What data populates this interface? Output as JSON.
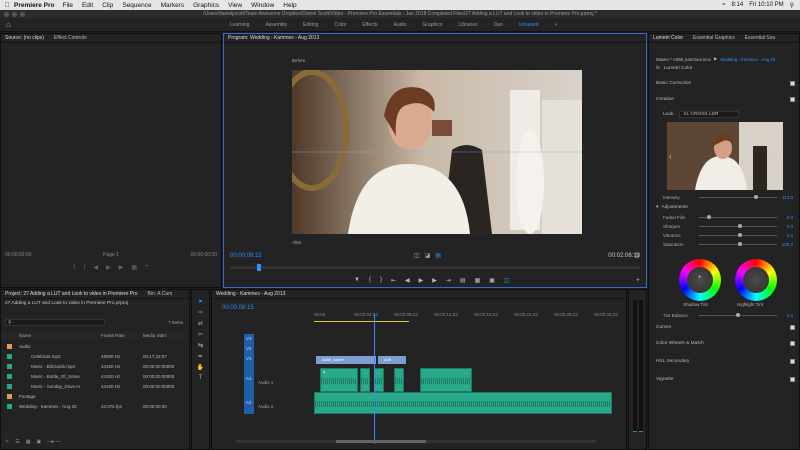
{
  "menubar": {
    "app": "Premiere Pro",
    "items": [
      "File",
      "Edit",
      "Clip",
      "Sequence",
      "Markers",
      "Graphics",
      "View",
      "Window",
      "Help"
    ],
    "right": [
      "8:14",
      "Fri 10:10 PM"
    ]
  },
  "pathbar": {
    "text": "/Users/danieljscott/Team Awesome Dropbox/Daniel Scott/Video - Premiere Pro Essentials - Jan 2018 Completed Files/27 Adding a LUT and Look to video in Premiere Pro.prproj *"
  },
  "workspaces": {
    "tabs": [
      "Learning",
      "Assembly",
      "Editing",
      "Color",
      "Effects",
      "Audio",
      "Graphics",
      "Libraries",
      "Dan",
      "Unsaved"
    ],
    "active": "Unsaved"
  },
  "source": {
    "tabs": [
      "Source: (no clips)",
      "Effect Controls"
    ],
    "tc_left": "00;00;00;00",
    "page": "Page 1",
    "tc_right": "00;00;00;00"
  },
  "program": {
    "title": "Program: Wedding - Kammes - Aug 2013",
    "before": "Before",
    "after": "After",
    "tc": "00:00:08:15",
    "duration": "00:02:06:13",
    "playhead_fraction": 0.065
  },
  "lumetri": {
    "tabs": [
      "Lumetri Color",
      "Essential Graphics",
      "Essential Sou"
    ],
    "master": "Master * A086_kammes.mov",
    "seq": "Wedding - Kammes - Aug 20...",
    "fx": "Lumetri Color",
    "basic": "Basic Correction",
    "creative": "Creative",
    "look_label": "Look",
    "look_value": "SL CROSS LDR",
    "intensity_label": "Intensity",
    "intensity_value": "113.0",
    "adjustments": "Adjustments",
    "sliders": [
      {
        "label": "Faded Film",
        "value": "0.0",
        "pos": 0.1
      },
      {
        "label": "Sharpen",
        "value": "0.0",
        "pos": 0.5
      },
      {
        "label": "Vibrance",
        "value": "0.0",
        "pos": 0.5
      },
      {
        "label": "Saturation",
        "value": "100.0",
        "pos": 0.5
      }
    ],
    "shadow_tint": "Shadow Tint",
    "highlight_tint": "Highlight Tint",
    "tint_balance_label": "Tint Balance",
    "tint_balance_value": "0.0",
    "sections": [
      "Curves",
      "Color Wheels & Match",
      "HSL Secondary",
      "Vignette"
    ]
  },
  "project": {
    "tabs": [
      "Project: 27 Adding a LUT and Look to video in Premiere Pro",
      "Bin: A Cam"
    ],
    "file": "27 Adding a LUT and Look to video in Premiere Pro.prproj",
    "items_count": "7 Items",
    "columns": [
      "Name",
      "Frame Rate",
      "Media Start"
    ],
    "rows": [
      {
        "name": "Audio",
        "rate": "",
        "start": "",
        "color": "#e0a050",
        "indent": 0
      },
      {
        "name": "Celebrant.mp3",
        "rate": "48000 Hz",
        "start": "00;17;22;07",
        "color": "#2aa88a",
        "indent": 1
      },
      {
        "name": "Music - Blizzards.mp3",
        "rate": "44100 Hz",
        "start": "00:00:00:00000",
        "color": "#2aa88a",
        "indent": 1
      },
      {
        "name": "Music - Bottle_Of_Some",
        "rate": "44100 Hz",
        "start": "00:00:00:00000",
        "color": "#2aa88a",
        "indent": 1
      },
      {
        "name": "Music - Sunday_Drive.m",
        "rate": "44100 Hz",
        "start": "00:00:00:00000",
        "color": "#2aa88a",
        "indent": 1
      },
      {
        "name": "Footage",
        "rate": "",
        "start": "",
        "color": "#e0a050",
        "indent": 0
      },
      {
        "name": "Wedding - Kammes - Aug 20",
        "rate": "23.976 fps",
        "start": "00;00;00;00",
        "color": "#2aa88a",
        "indent": 0
      }
    ]
  },
  "timeline": {
    "title": "Wedding - Kammes - Aug 2013",
    "tc": "00:00:08:15",
    "ruler": [
      "00:00",
      "00:00:04:23",
      "00:00:09:23",
      "00:00:14:23",
      "00:00:19:23",
      "00:00:24:23",
      "00:00:29:23",
      "00:00:34:23"
    ],
    "tracks": [
      {
        "name": "V3"
      },
      {
        "name": "V2"
      },
      {
        "name": "V1"
      },
      {
        "name": "A1",
        "label": "Audio 1"
      },
      {
        "name": "A2",
        "label": "Audio 2"
      }
    ],
    "video_clips": [
      "A086_kamm",
      "A08"
    ],
    "audio_clip_label": "A"
  },
  "meters": {
    "labels": [
      "0",
      "-12",
      "-24",
      "-36",
      "-48",
      "dB"
    ]
  }
}
